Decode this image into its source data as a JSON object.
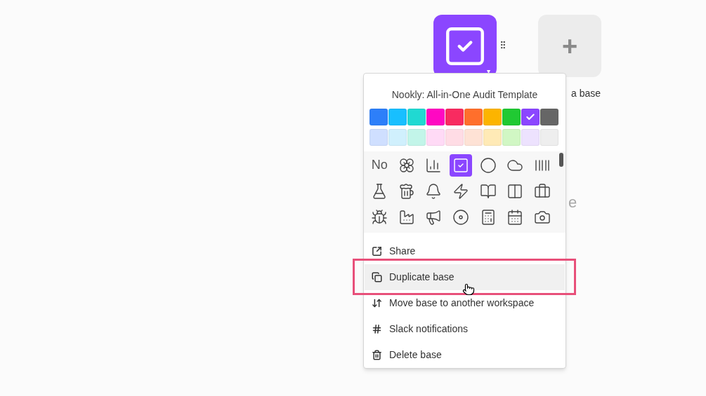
{
  "base_tile": {
    "dropdown": "▾"
  },
  "add_tile": {
    "label": "+"
  },
  "behind_texts": [
    "a base",
    "e"
  ],
  "menu": {
    "title": "Nookly: All-in-One Audit Template",
    "color_rows": [
      [
        {
          "color": "#2d7ff9",
          "selected": false
        },
        {
          "color": "#18bfff",
          "selected": false
        },
        {
          "color": "#20d9d2",
          "selected": false
        },
        {
          "color": "#ff08c2",
          "selected": false
        },
        {
          "color": "#f82b60",
          "selected": false
        },
        {
          "color": "#ff6f2c",
          "selected": false
        },
        {
          "color": "#fcb400",
          "selected": false
        },
        {
          "color": "#20c933",
          "selected": false
        },
        {
          "color": "#8b46ff",
          "selected": true
        },
        {
          "color": "#666666",
          "selected": false
        }
      ],
      [
        {
          "color": "#cfdfff",
          "selected": false
        },
        {
          "color": "#d0f0fd",
          "selected": false
        },
        {
          "color": "#c2f5e9",
          "selected": false
        },
        {
          "color": "#ffdaf6",
          "selected": false
        },
        {
          "color": "#ffdce5",
          "selected": false
        },
        {
          "color": "#fee2d5",
          "selected": false
        },
        {
          "color": "#ffeab6",
          "selected": false
        },
        {
          "color": "#d1f7c4",
          "selected": false
        },
        {
          "color": "#ede2fe",
          "selected": false
        },
        {
          "color": "#eeeeee",
          "selected": false
        }
      ]
    ],
    "icons": [
      {
        "kind": "text",
        "label": "No",
        "selected": false
      },
      {
        "kind": "icon",
        "selected": false
      },
      {
        "kind": "icon",
        "selected": false
      },
      {
        "kind": "icon",
        "selected": true
      },
      {
        "kind": "icon",
        "selected": false
      },
      {
        "kind": "icon",
        "selected": false
      },
      {
        "kind": "icon",
        "selected": false
      },
      {
        "kind": "icon",
        "selected": false
      },
      {
        "kind": "icon",
        "selected": false
      },
      {
        "kind": "icon",
        "selected": false
      },
      {
        "kind": "icon",
        "selected": false
      },
      {
        "kind": "icon",
        "selected": false
      },
      {
        "kind": "icon",
        "selected": false
      },
      {
        "kind": "icon",
        "selected": false
      },
      {
        "kind": "icon",
        "selected": false
      },
      {
        "kind": "icon",
        "selected": false
      },
      {
        "kind": "icon",
        "selected": false
      },
      {
        "kind": "icon",
        "selected": false
      },
      {
        "kind": "icon",
        "selected": false
      },
      {
        "kind": "icon",
        "selected": false
      },
      {
        "kind": "icon",
        "selected": false
      }
    ],
    "items": [
      {
        "label": "Share",
        "highlighted": false
      },
      {
        "label": "Duplicate base",
        "highlighted": true
      },
      {
        "label": "Move base to another workspace",
        "highlighted": false
      },
      {
        "label": "Slack notifications",
        "highlighted": false
      },
      {
        "label": "Delete base",
        "highlighted": false
      }
    ]
  }
}
